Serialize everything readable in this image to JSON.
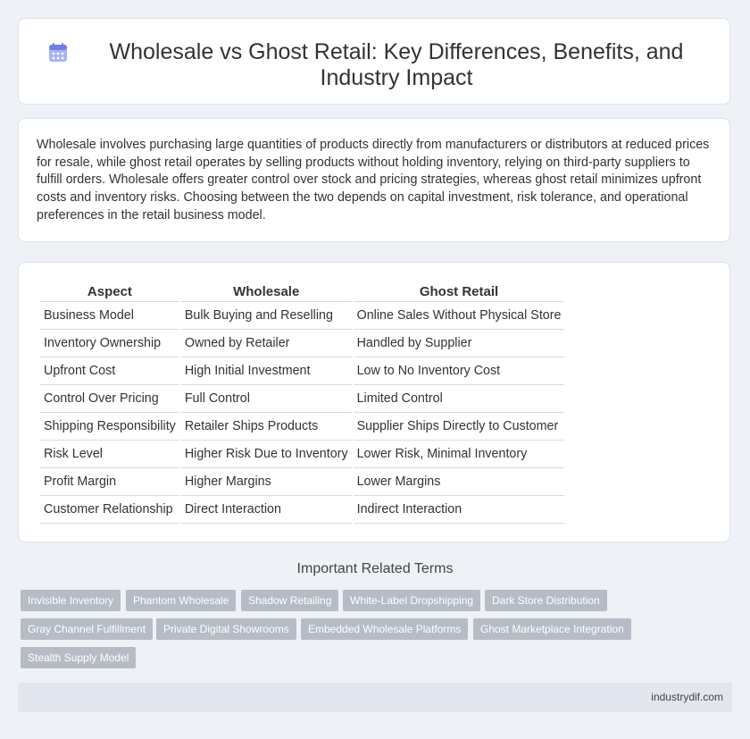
{
  "header": {
    "title": "Wholesale vs Ghost Retail: Key Differences, Benefits, and Industry Impact",
    "icon": "calendar-icon"
  },
  "intro": {
    "text": "Wholesale involves purchasing large quantities of products directly from manufacturers or distributors at reduced prices for resale, while ghost retail operates by selling products without holding inventory, relying on third-party suppliers to fulfill orders. Wholesale offers greater control over stock and pricing strategies, whereas ghost retail minimizes upfront costs and inventory risks. Choosing between the two depends on capital investment, risk tolerance, and operational preferences in the retail business model."
  },
  "table": {
    "headers": [
      "Aspect",
      "Wholesale",
      "Ghost Retail"
    ],
    "rows": [
      [
        "Business Model",
        "Bulk Buying and Reselling",
        "Online Sales Without Physical Store"
      ],
      [
        "Inventory Ownership",
        "Owned by Retailer",
        "Handled by Supplier"
      ],
      [
        "Upfront Cost",
        "High Initial Investment",
        "Low to No Inventory Cost"
      ],
      [
        "Control Over Pricing",
        "Full Control",
        "Limited Control"
      ],
      [
        "Shipping Responsibility",
        "Retailer Ships Products",
        "Supplier Ships Directly to Customer"
      ],
      [
        "Risk Level",
        "Higher Risk Due to Inventory",
        "Lower Risk, Minimal Inventory"
      ],
      [
        "Profit Margin",
        "Higher Margins",
        "Lower Margins"
      ],
      [
        "Customer Relationship",
        "Direct Interaction",
        "Indirect Interaction"
      ]
    ]
  },
  "related": {
    "title": "Important Related Terms",
    "tags": [
      "Invisible Inventory",
      "Phantom Wholesale",
      "Shadow Retailing",
      "White-Label Dropshipping",
      "Dark Store Distribution",
      "Gray Channel Fulfillment",
      "Private Digital Showrooms",
      "Embedded Wholesale Platforms",
      "Ghost Marketplace Integration",
      "Stealth Supply Model"
    ]
  },
  "footer": {
    "site": "industrydif.com"
  },
  "colors": {
    "tag_bg": "#b6bcc6",
    "page_bg": "#eef1f6",
    "icon_accent": "#6f7fe6"
  }
}
